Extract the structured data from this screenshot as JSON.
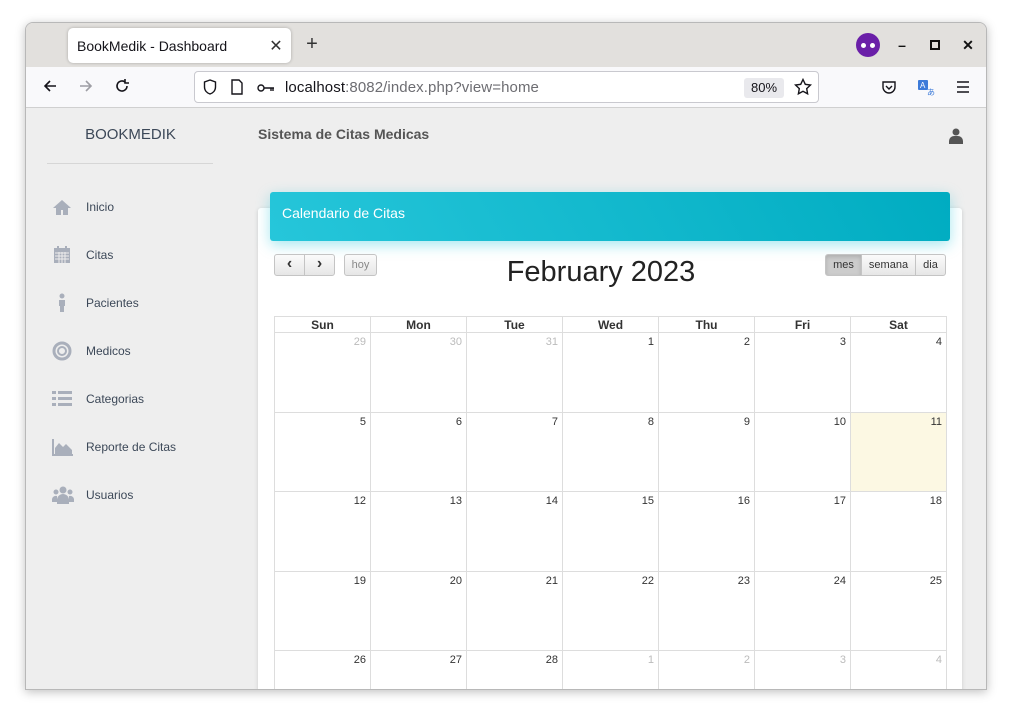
{
  "browser": {
    "tab_title": "BookMedik - Dashboard",
    "tab_close": "✕",
    "new_tab": "+",
    "url_host": "localhost",
    "url_rest": ":8082/index.php?view=home",
    "zoom": "80%"
  },
  "sidebar": {
    "brand": "BOOKMEDIK",
    "items": [
      {
        "label": "Inicio",
        "icon": "home-icon"
      },
      {
        "label": "Citas",
        "icon": "calendar-icon"
      },
      {
        "label": "Pacientes",
        "icon": "person-icon"
      },
      {
        "label": "Medicos",
        "icon": "life-ring-icon"
      },
      {
        "label": "Categorias",
        "icon": "list-icon"
      },
      {
        "label": "Reporte de Citas",
        "icon": "area-chart-icon"
      },
      {
        "label": "Usuarios",
        "icon": "users-icon"
      }
    ]
  },
  "main": {
    "title": "Sistema de Citas Medicas",
    "card_title": "Calendario de Citas"
  },
  "calendar": {
    "title": "February 2023",
    "prev": "‹",
    "next": "›",
    "today_btn": "hoy",
    "views": [
      "mes",
      "semana",
      "dia"
    ],
    "active_view": "mes",
    "day_headers": [
      "Sun",
      "Mon",
      "Tue",
      "Wed",
      "Thu",
      "Fri",
      "Sat"
    ],
    "weeks": [
      [
        "29",
        "30",
        "31",
        "1",
        "2",
        "3",
        "4"
      ],
      [
        "5",
        "6",
        "7",
        "8",
        "9",
        "10",
        "11"
      ],
      [
        "12",
        "13",
        "14",
        "15",
        "16",
        "17",
        "18"
      ],
      [
        "19",
        "20",
        "21",
        "22",
        "23",
        "24",
        "25"
      ],
      [
        "26",
        "27",
        "28",
        "1",
        "2",
        "3",
        "4"
      ]
    ],
    "today": "11",
    "today_color": "#fcf8e3"
  },
  "colors": {
    "header_gradient_start": "#26c6da",
    "header_gradient_end": "#00acc1",
    "sidebar_bg": "#eeeeee"
  }
}
